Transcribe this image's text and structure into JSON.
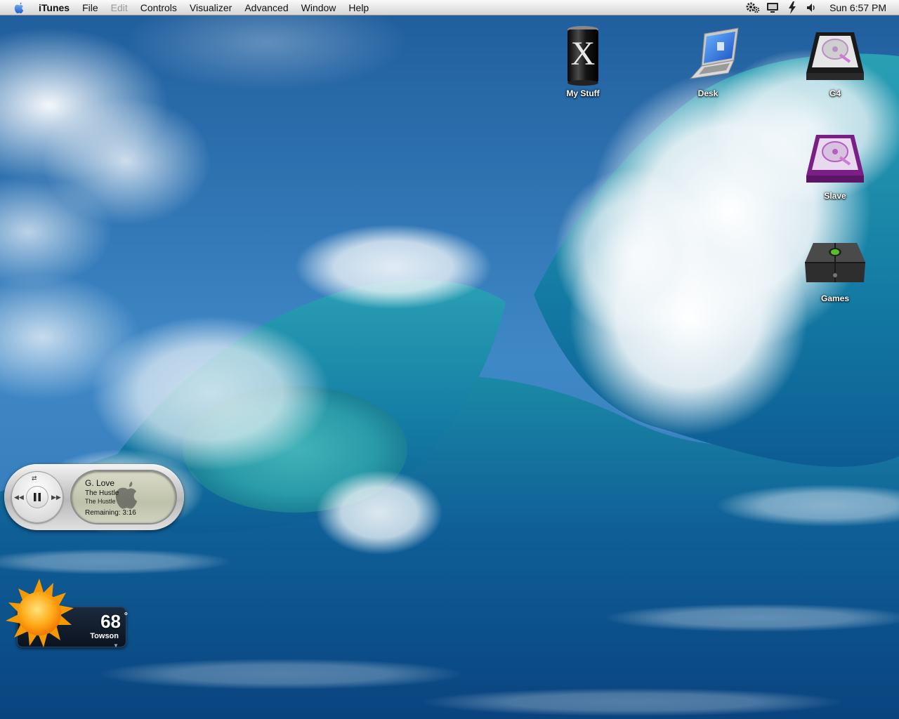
{
  "menubar": {
    "apple_icon": "apple-icon",
    "app_name": "iTunes",
    "items": [
      "File",
      "Edit",
      "Controls",
      "Visualizer",
      "Advanced",
      "Window",
      "Help"
    ],
    "disabled_items": [
      "Edit"
    ],
    "status_icons": [
      "gear-icon",
      "display-icon",
      "bolt-icon",
      "volume-icon"
    ],
    "clock": "Sun 6:57 PM"
  },
  "desktop": {
    "icons": [
      {
        "label": "My Stuff",
        "icon": "osx-can-icon"
      },
      {
        "label": "Desk",
        "icon": "laptop-icon"
      },
      {
        "label": "G4",
        "icon": "hard-drive-icon"
      },
      {
        "label": "Slave",
        "icon": "hard-drive-purple-icon"
      },
      {
        "label": "Games",
        "icon": "xbox-icon"
      }
    ]
  },
  "itunes_widget": {
    "artist": "G. Love",
    "album": "The Hustle",
    "song": "The Hustle",
    "remaining": "Remaining: 3:16",
    "controls": [
      "shuffle-icon",
      "previous-icon",
      "pause-icon",
      "next-icon"
    ]
  },
  "weather_widget": {
    "temperature": "68",
    "degree_symbol": "°",
    "city": "Towson",
    "condition_icon": "sun-icon"
  },
  "colors": {
    "sea_deep": "#0b4f8a",
    "sea_teal": "#2fa3b6",
    "foam": "#f2f6f8",
    "sky": "#3d82c0",
    "menubar": "#e4e4e4"
  }
}
